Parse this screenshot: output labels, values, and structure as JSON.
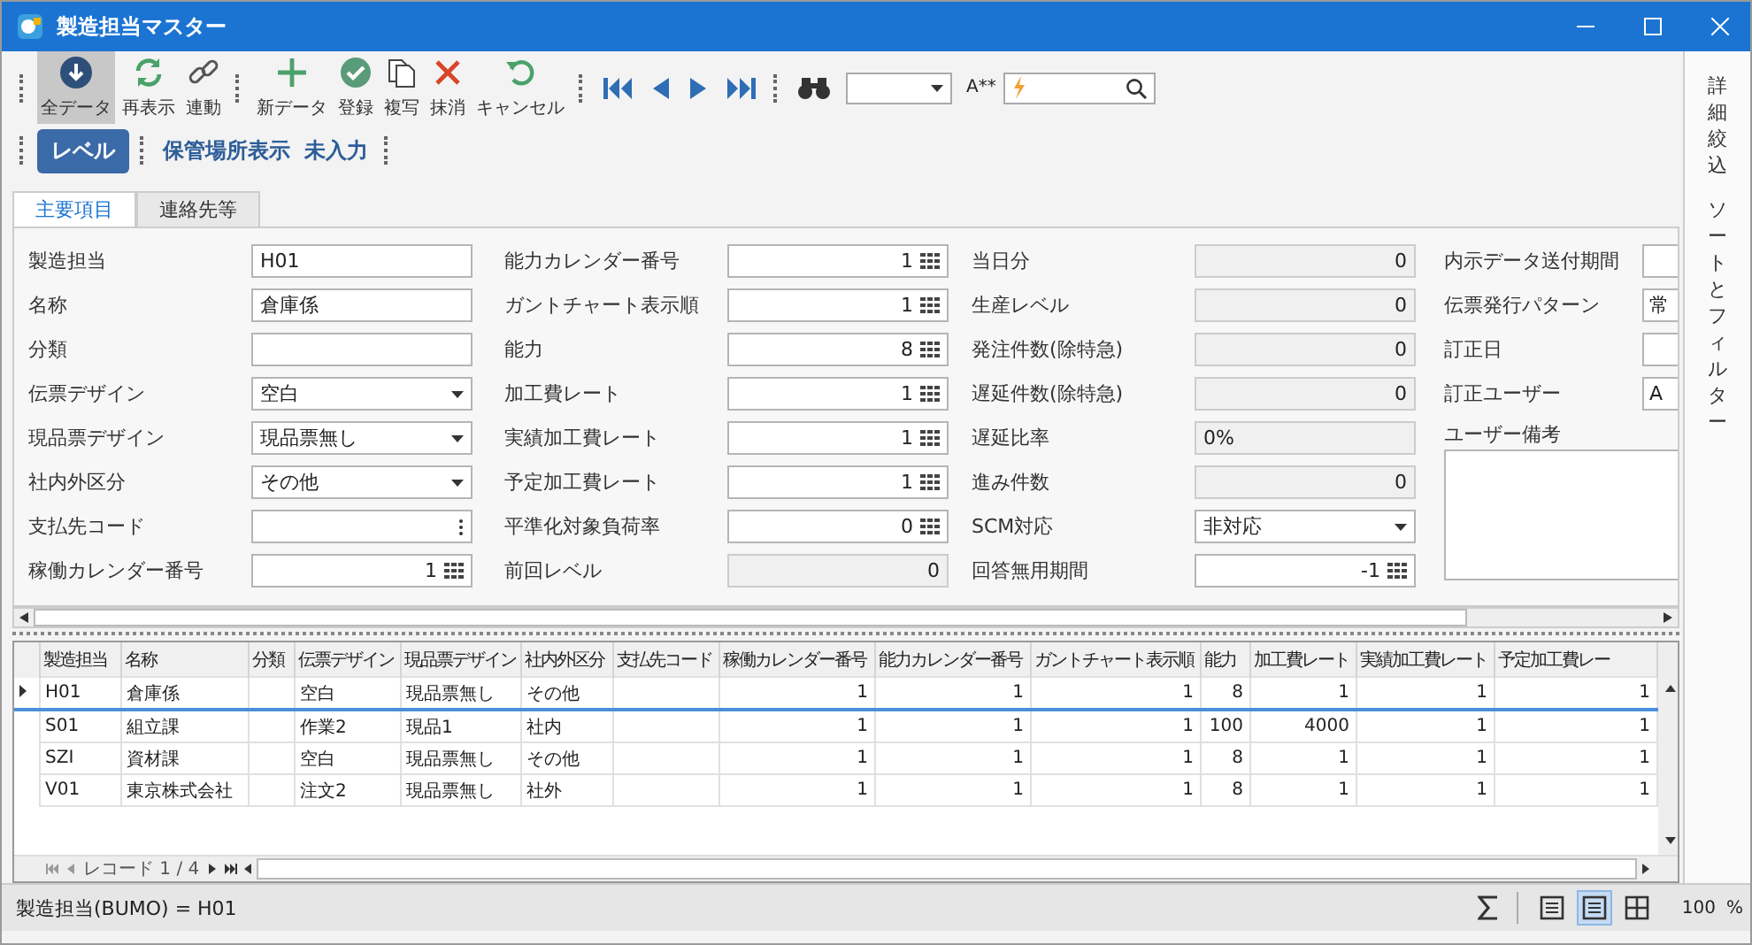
{
  "window": {
    "title": "製造担当マスター"
  },
  "toolbar": {
    "buttons": [
      {
        "label": "全データ",
        "selected": true
      },
      {
        "label": "再表示",
        "selected": false
      },
      {
        "label": "連動",
        "selected": false
      },
      {
        "label": "新データ",
        "selected": false
      },
      {
        "label": "登録",
        "selected": false
      },
      {
        "label": "複写",
        "selected": false
      },
      {
        "label": "抹消",
        "selected": false
      },
      {
        "label": "キャンセル",
        "selected": false
      }
    ],
    "font_label": "A**"
  },
  "views": [
    {
      "label": "レベル",
      "selected": true
    },
    {
      "label": "保管場所表示",
      "selected": false
    },
    {
      "label": "未入力",
      "selected": false
    }
  ],
  "side_panel": {
    "tabs": [
      "詳細絞込",
      "ソートとフィルター"
    ]
  },
  "tabs": [
    {
      "label": "主要項目",
      "selected": true
    },
    {
      "label": "連絡先等",
      "selected": false
    }
  ],
  "form": {
    "columns": [
      [
        {
          "label": "製造担当",
          "kind": "text",
          "value": "H01"
        },
        {
          "label": "名称",
          "kind": "text",
          "value": "倉庫係"
        },
        {
          "label": "分類",
          "kind": "text"
        },
        {
          "label": "伝票デザイン",
          "kind": "select",
          "value": "空白"
        },
        {
          "label": "現品票デザイン",
          "kind": "select",
          "value": "現品票無し"
        },
        {
          "label": "社内外区分",
          "kind": "select",
          "value": "その他"
        },
        {
          "label": "支払先コード",
          "kind": "lookup"
        },
        {
          "label": "稼働カレンダー番号",
          "kind": "number",
          "value": "1"
        }
      ],
      [
        {
          "label": "能力カレンダー番号",
          "kind": "number",
          "value": "1"
        },
        {
          "label": "ガントチャート表示順",
          "kind": "number",
          "value": "1"
        },
        {
          "label": "能力",
          "kind": "number",
          "value": "8"
        },
        {
          "label": "加工費レート",
          "kind": "number",
          "value": "1"
        },
        {
          "label": "実績加工費レート",
          "kind": "number",
          "value": "1"
        },
        {
          "label": "予定加工費レート",
          "kind": "number",
          "value": "1"
        },
        {
          "label": "平準化対象負荷率",
          "kind": "number",
          "value": "0"
        },
        {
          "label": "前回レベル",
          "kind": "readonly_number",
          "value": "0"
        }
      ],
      [
        {
          "label": "当日分",
          "kind": "readonly_number",
          "value": "0"
        },
        {
          "label": "生産レベル",
          "kind": "readonly_number",
          "value": "0"
        },
        {
          "label": "発注件数(除特急)",
          "kind": "readonly_number",
          "value": "0"
        },
        {
          "label": "遅延件数(除特急)",
          "kind": "readonly_number",
          "value": "0"
        },
        {
          "label": "遅延比率",
          "kind": "readonly_text",
          "value": "0%"
        },
        {
          "label": "進み件数",
          "kind": "readonly_number",
          "value": "0"
        },
        {
          "label": "SCM対応",
          "kind": "select",
          "value": "非対応"
        },
        {
          "label": "回答無用期間",
          "kind": "number",
          "value": "-1"
        }
      ],
      [
        {
          "label": "内示データ送付期間",
          "kind": "text"
        },
        {
          "label": "伝票発行パターン",
          "kind": "text",
          "value": "常"
        },
        {
          "label": "訂正日",
          "kind": "text"
        },
        {
          "label": "訂正ユーザー",
          "kind": "text",
          "value": "A"
        },
        {
          "label": "ユーザー備考",
          "kind": "memo"
        }
      ]
    ]
  },
  "table": {
    "columns": [
      {
        "label": "製造担当",
        "kind": "text"
      },
      {
        "label": "名称",
        "kind": "text"
      },
      {
        "label": "分類",
        "kind": "text"
      },
      {
        "label": "伝票デザイン",
        "kind": "text"
      },
      {
        "label": "現品票デザイン",
        "kind": "text"
      },
      {
        "label": "社内外区分",
        "kind": "text"
      },
      {
        "label": "支払先コード",
        "kind": "text"
      },
      {
        "label": "稼働カレンダー番号",
        "kind": "number"
      },
      {
        "label": "能力カレンダー番号",
        "kind": "number"
      },
      {
        "label": "ガントチャート表示順",
        "kind": "number"
      },
      {
        "label": "能力",
        "kind": "number"
      },
      {
        "label": "加工費レート",
        "kind": "number"
      },
      {
        "label": "実績加工費レート",
        "kind": "number"
      },
      {
        "label": "予定加工費レー",
        "kind": "number"
      }
    ],
    "rows": [
      {
        "selected": true,
        "cells": [
          "H01",
          "倉庫係",
          "",
          "空白",
          "現品票無し",
          "その他",
          "",
          "1",
          "1",
          "1",
          "8",
          "1",
          "1",
          "1"
        ]
      },
      {
        "selected": false,
        "cells": [
          "S01",
          "組立課",
          "",
          "作業2",
          "現品1",
          "社内",
          "",
          "1",
          "1",
          "1",
          "100",
          "4000",
          "1",
          "1"
        ]
      },
      {
        "selected": false,
        "cells": [
          "SZI",
          "資材課",
          "",
          "空白",
          "現品票無し",
          "その他",
          "",
          "1",
          "1",
          "1",
          "8",
          "1",
          "1",
          "1"
        ]
      },
      {
        "selected": false,
        "cells": [
          "V01",
          "東京株式会社",
          "",
          "注文2",
          "現品票無し",
          "社外",
          "",
          "1",
          "1",
          "1",
          "8",
          "1",
          "1",
          "1"
        ]
      }
    ],
    "record_label": "レコード 1 / 4"
  },
  "status_bar": {
    "text": "製造担当(BUMO) = H01",
    "views": [
      {
        "selected": false
      },
      {
        "selected": true
      },
      {
        "selected": false
      }
    ],
    "zoom": "100",
    "zoom_unit": "%"
  }
}
